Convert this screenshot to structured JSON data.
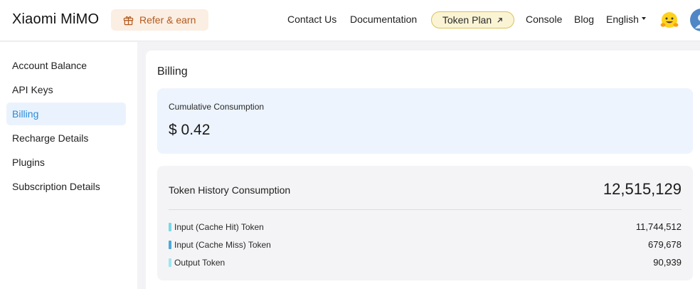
{
  "header": {
    "logo": "Xiaomi MiMO",
    "refer_label": "Refer & earn",
    "nav": {
      "contact": "Contact Us",
      "documentation": "Documentation",
      "token_plan": "Token Plan",
      "console": "Console",
      "blog": "Blog",
      "language": "English"
    }
  },
  "sidebar": {
    "items": [
      {
        "label": "Account Balance"
      },
      {
        "label": "API Keys"
      },
      {
        "label": "Billing",
        "active": true
      },
      {
        "label": "Recharge Details"
      },
      {
        "label": "Plugins"
      },
      {
        "label": "Subscription Details"
      }
    ]
  },
  "billing": {
    "title": "Billing",
    "cumulative": {
      "label": "Cumulative Consumption",
      "value": "$ 0.42"
    },
    "token_history": {
      "title": "Token History Consumption",
      "total": "12,515,129",
      "rows": [
        {
          "label": "Input (Cache Hit) Token",
          "value": "11,744,512",
          "color": "#7ad8e6"
        },
        {
          "label": "Input (Cache Miss) Token",
          "value": "679,678",
          "color": "#4fa8d8"
        },
        {
          "label": "Output Token",
          "value": "90,939",
          "color": "#9ee6f0"
        }
      ]
    }
  },
  "colors": {
    "accent": "#2b8ad8",
    "refer_bg": "#fbeee2",
    "token_plan_bg": "#fbf4d4",
    "cumulative_card_bg": "#edf4fd"
  }
}
